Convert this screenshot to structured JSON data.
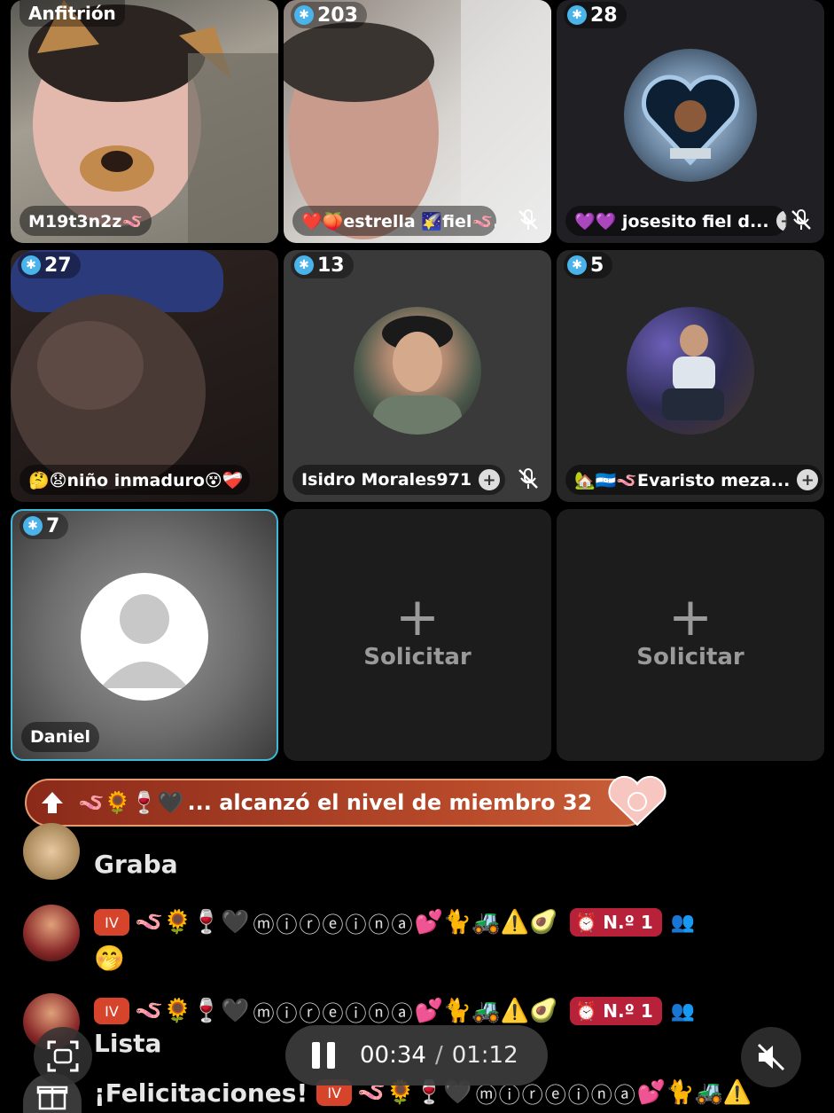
{
  "host_label": "Anfitrión",
  "tiles": [
    {
      "name": "M19t3n2z🪱",
      "count": null,
      "kind": "host",
      "muted": false,
      "follow": false
    },
    {
      "name": "❤️🍑estrella 🌠fiel🪱...",
      "count": "203",
      "kind": "video",
      "muted": true,
      "follow": false
    },
    {
      "name": "💜💜 josesito fiel d...",
      "count": "28",
      "kind": "avatar",
      "muted": true,
      "follow": true
    },
    {
      "name": "🤔😧niño inmaduro😵❤️‍🩹",
      "count": "27",
      "kind": "video",
      "muted": false,
      "follow": false
    },
    {
      "name": "Isidro Morales971",
      "count": "13",
      "kind": "avatar",
      "muted": true,
      "follow": true
    },
    {
      "name": "🏡🇭🇳🪱Evaristo meza...",
      "count": "5",
      "kind": "avatar",
      "muted": false,
      "follow": true
    },
    {
      "name": "Daniel",
      "count": "7",
      "kind": "placeholder",
      "muted": false,
      "follow": false,
      "selected": true
    },
    {
      "name": "",
      "count": null,
      "kind": "request",
      "label": "Solicitar"
    },
    {
      "name": "",
      "count": null,
      "kind": "request",
      "label": "Solicitar"
    }
  ],
  "request_plus": "+",
  "banner": {
    "emojis": "🪱🌻🍷🖤",
    "text": "... alcanzó el nivel de miembro 32"
  },
  "chat": [
    {
      "text": "Graba"
    },
    {
      "level_badge": "IV",
      "emojis": "🪱🌻🍷🖤",
      "name": "ⓜⓘⓡⓔⓘⓝⓐ",
      "emojis_after": "💕🐈🚜⚠️🥑",
      "rank": "N.º 1",
      "message": "🤭"
    },
    {
      "level_badge": "IV",
      "emojis": "🪱🌻🍷🖤",
      "name": "ⓜⓘⓡⓔⓘⓝⓐ",
      "emojis_after": "💕🐈🚜⚠️🥑",
      "rank": "N.º 1",
      "message": "Lista"
    },
    {
      "message": "¡Felicitaciones!",
      "level_badge": "IV",
      "emojis": "🪱🌻🍷🖤",
      "name": "ⓜⓘⓡⓔⓘⓝⓐ",
      "emojis_after": "💕🐈🚜⚠️"
    }
  ],
  "player": {
    "current_time": "00:34",
    "separator": "/",
    "total_time": "01:12"
  },
  "colors": {
    "accent_blue": "#4ab3ea",
    "selected_border": "#3fb7d6",
    "banner_red": "#b84a2a",
    "rank_badge": "#b8213a"
  }
}
